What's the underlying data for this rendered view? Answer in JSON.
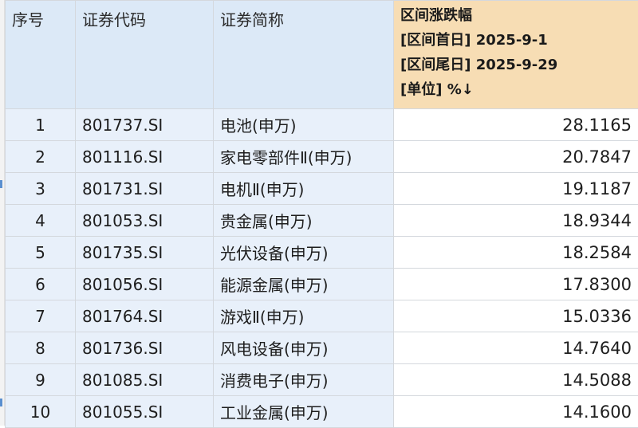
{
  "header": {
    "col_index": "序号",
    "col_code": "证券代码",
    "col_name": "证券简称",
    "col_value_lines": [
      "区间涨跌幅",
      "[区间首日] 2025-9-1",
      "[区间尾日] 2025-9-29",
      "[单位] %↓"
    ]
  },
  "rows": [
    {
      "index": "1",
      "code": "801737.SI",
      "name": "电池(申万)",
      "value": "28.1165"
    },
    {
      "index": "2",
      "code": "801116.SI",
      "name": "家电零部件Ⅱ(申万)",
      "value": "20.7847"
    },
    {
      "index": "3",
      "code": "801731.SI",
      "name": "电机Ⅱ(申万)",
      "value": "19.1187"
    },
    {
      "index": "4",
      "code": "801053.SI",
      "name": "贵金属(申万)",
      "value": "18.9344"
    },
    {
      "index": "5",
      "code": "801735.SI",
      "name": "光伏设备(申万)",
      "value": "18.2584"
    },
    {
      "index": "6",
      "code": "801056.SI",
      "name": "能源金属(申万)",
      "value": "17.8300"
    },
    {
      "index": "7",
      "code": "801764.SI",
      "name": "游戏Ⅱ(申万)",
      "value": "15.0336"
    },
    {
      "index": "8",
      "code": "801736.SI",
      "name": "风电设备(申万)",
      "value": "14.7640"
    },
    {
      "index": "9",
      "code": "801085.SI",
      "name": "消费电子(申万)",
      "value": "14.5088"
    },
    {
      "index": "10",
      "code": "801055.SI",
      "name": "工业金属(申万)",
      "value": "14.1600"
    }
  ],
  "colors": {
    "header_bg": "#dce9f7",
    "sorted_header_bg": "#f7ddb4",
    "row_bg": "#e8f0fa",
    "grid_line": "#d4d8dd"
  }
}
